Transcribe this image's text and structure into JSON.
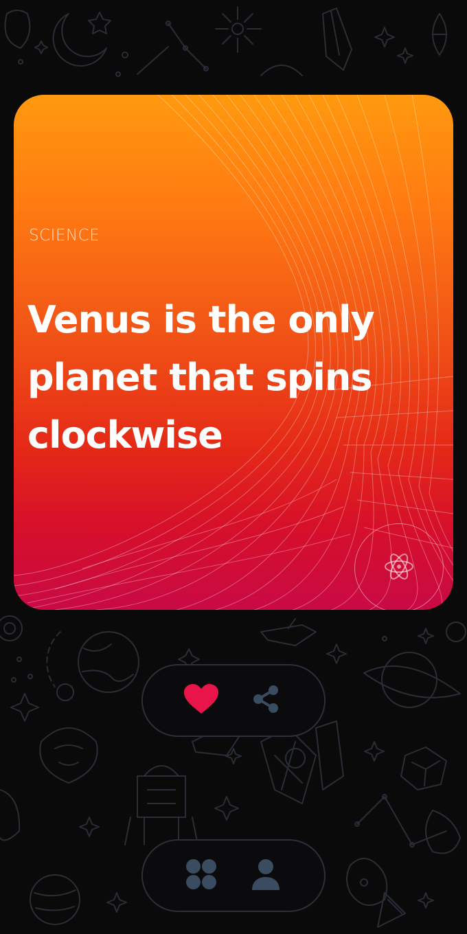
{
  "card": {
    "category": "SCIENCE",
    "fact": "Venus is the only planet that spins clockwise",
    "category_icon": "atom-icon"
  },
  "actions": {
    "like_icon": "heart-icon",
    "share_icon": "share-icon"
  },
  "nav": {
    "categories_icon": "grid-icon",
    "profile_icon": "user-icon"
  },
  "colors": {
    "background": "#0a0a0b",
    "gradient_top": "#ff990f",
    "gradient_bottom": "#c90a45",
    "heart": "#e8154a",
    "icon_muted": "#3a4c60"
  }
}
